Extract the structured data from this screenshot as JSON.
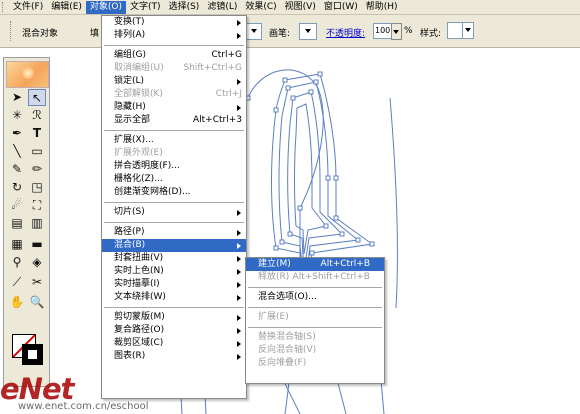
{
  "menubar": {
    "items": [
      "文件(F)",
      "编辑(E)",
      "对象(O)",
      "文字(T)",
      "选择(S)",
      "滤镜(L)",
      "效果(C)",
      "视图(V)",
      "窗口(W)",
      "帮助(H)"
    ]
  },
  "toolbar": {
    "title": "混合对象",
    "fill_label": "填",
    "stroke_label": "画笔:",
    "opacity_label": "不透明度:",
    "opacity_value": "100",
    "percent": "%",
    "style_label": "样式:"
  },
  "object_menu": {
    "items": [
      {
        "label": "变换(T)",
        "shortcut": "",
        "submenu": true,
        "disabled": false
      },
      {
        "label": "排列(A)",
        "shortcut": "",
        "submenu": true,
        "disabled": false
      },
      {
        "sep": true
      },
      {
        "label": "编组(G)",
        "shortcut": "Ctrl+G",
        "submenu": false,
        "disabled": false
      },
      {
        "label": "取消编组(U)",
        "shortcut": "Shift+Ctrl+G",
        "submenu": false,
        "disabled": true
      },
      {
        "label": "锁定(L)",
        "shortcut": "",
        "submenu": true,
        "disabled": false
      },
      {
        "label": "全部解锁(K)",
        "shortcut": "Ctrl+J",
        "submenu": false,
        "disabled": true
      },
      {
        "label": "隐藏(H)",
        "shortcut": "",
        "submenu": true,
        "disabled": false
      },
      {
        "label": "显示全部",
        "shortcut": "Alt+Ctrl+3",
        "submenu": false,
        "disabled": false
      },
      {
        "sep": true
      },
      {
        "label": "扩展(X)...",
        "shortcut": "",
        "submenu": false,
        "disabled": false
      },
      {
        "label": "扩展外观(E)",
        "shortcut": "",
        "submenu": false,
        "disabled": true
      },
      {
        "label": "拼合透明度(F)...",
        "shortcut": "",
        "submenu": false,
        "disabled": false
      },
      {
        "label": "栅格化(Z)...",
        "shortcut": "",
        "submenu": false,
        "disabled": false
      },
      {
        "label": "创建渐变网格(D)...",
        "shortcut": "",
        "submenu": false,
        "disabled": false
      },
      {
        "sep": true
      },
      {
        "label": "切片(S)",
        "shortcut": "",
        "submenu": true,
        "disabled": false
      },
      {
        "sep": true
      },
      {
        "label": "路径(P)",
        "shortcut": "",
        "submenu": true,
        "disabled": false
      },
      {
        "label": "混合(B)",
        "shortcut": "",
        "submenu": true,
        "disabled": false,
        "highlight": true
      },
      {
        "label": "封套扭曲(V)",
        "shortcut": "",
        "submenu": true,
        "disabled": false
      },
      {
        "label": "实时上色(N)",
        "shortcut": "",
        "submenu": true,
        "disabled": false
      },
      {
        "label": "实时描摹(I)",
        "shortcut": "",
        "submenu": true,
        "disabled": false
      },
      {
        "label": "文本绕排(W)",
        "shortcut": "",
        "submenu": true,
        "disabled": false
      },
      {
        "sep": true
      },
      {
        "label": "剪切蒙版(M)",
        "shortcut": "",
        "submenu": true,
        "disabled": false
      },
      {
        "label": "复合路径(O)",
        "shortcut": "",
        "submenu": true,
        "disabled": false
      },
      {
        "label": "裁剪区域(C)",
        "shortcut": "",
        "submenu": true,
        "disabled": false
      },
      {
        "label": "图表(R)",
        "shortcut": "",
        "submenu": true,
        "disabled": false
      }
    ]
  },
  "blend_menu": {
    "items": [
      {
        "label": "建立(M)",
        "shortcut": "Alt+Ctrl+B",
        "disabled": false,
        "highlight": true
      },
      {
        "label": "释放(R)",
        "shortcut": "Alt+Shift+Ctrl+B",
        "disabled": true
      },
      {
        "sep": true
      },
      {
        "label": "混合选项(O)...",
        "shortcut": "",
        "disabled": false
      },
      {
        "sep": true
      },
      {
        "label": "扩展(E)",
        "shortcut": "",
        "disabled": true
      },
      {
        "sep": true
      },
      {
        "label": "替换混合轴(S)",
        "shortcut": "",
        "disabled": true
      },
      {
        "label": "反向混合轴(V)",
        "shortcut": "",
        "disabled": true
      },
      {
        "label": "反向堆叠(F)",
        "shortcut": "",
        "disabled": true
      }
    ]
  },
  "tools": {
    "icons": [
      "selection-arrow-icon",
      "direct-selection-icon",
      "magic-wand-icon",
      "lasso-icon",
      "pen-icon",
      "type-icon",
      "line-icon",
      "rectangle-icon",
      "paintbrush-icon",
      "pencil-icon",
      "rotate-icon",
      "scale-icon",
      "warp-icon",
      "free-transform-icon",
      "symbol-sprayer-icon",
      "graph-icon",
      "mesh-icon",
      "gradient-icon",
      "eyedropper-icon",
      "live-paint-icon",
      "slice-icon",
      "scissors-icon",
      "hand-icon",
      "zoom-icon"
    ]
  },
  "watermark": {
    "logo": "eNet",
    "url": "www.enet.com.cn/eschool"
  },
  "colors": {
    "menu_highlight": "#316ac5",
    "chrome": "#ece9d8",
    "path_stroke": "#5b7fc4",
    "watermark": "#a80000"
  }
}
